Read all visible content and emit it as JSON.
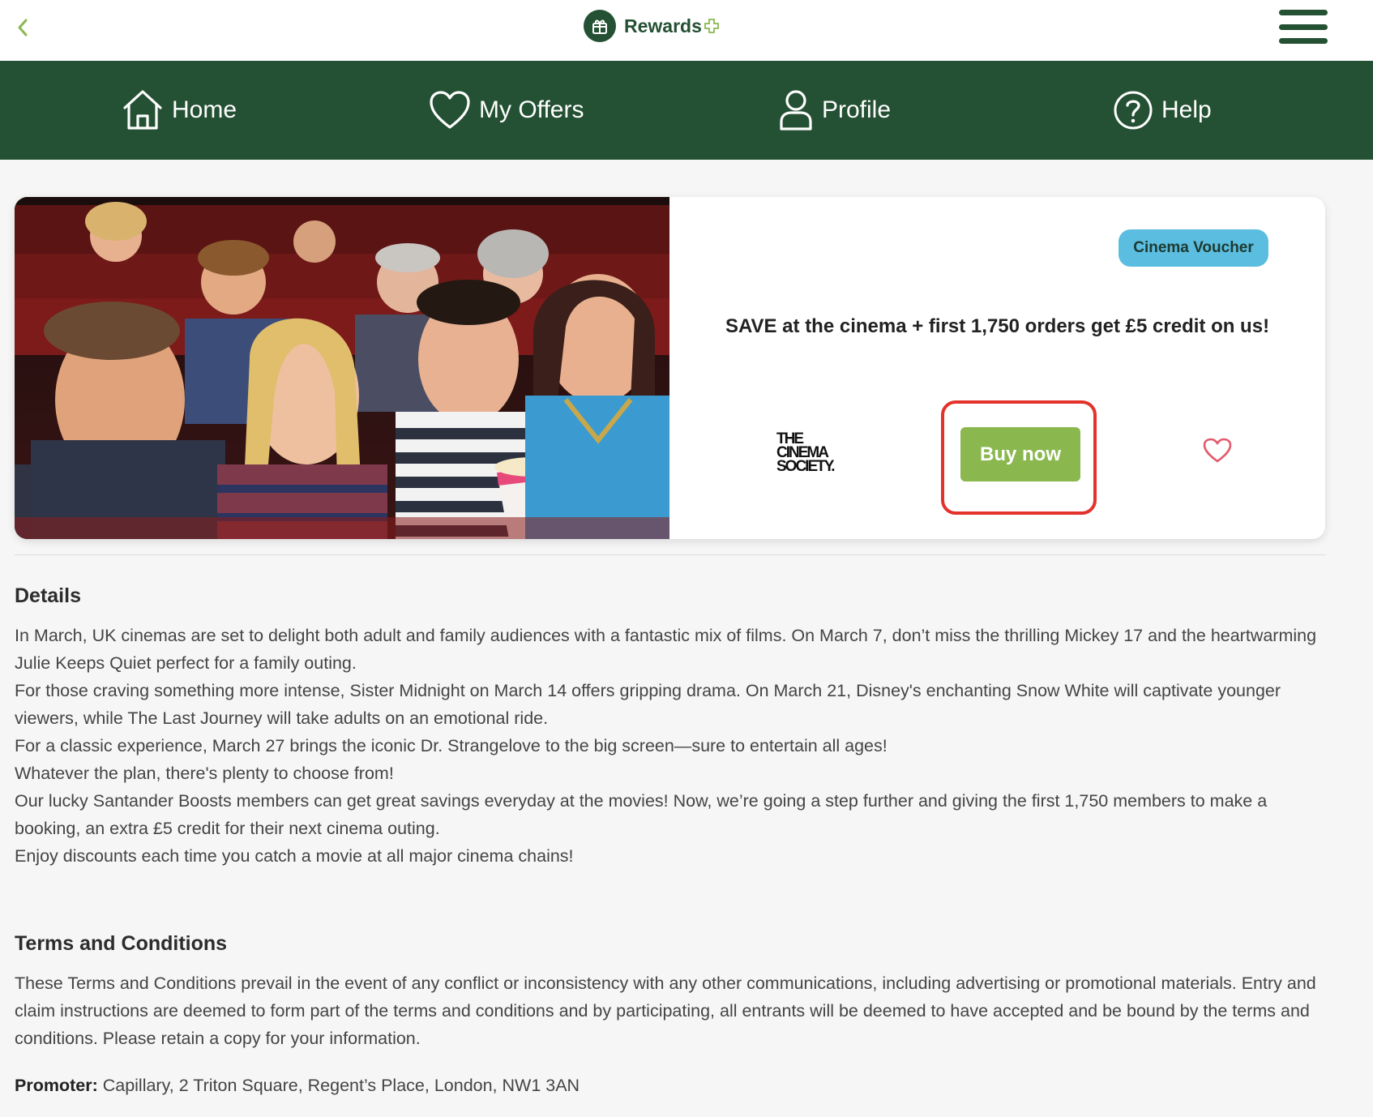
{
  "app": {
    "name": "Rewards",
    "brand_color": "#245033",
    "accent_color": "#8ab84f"
  },
  "topbar": {
    "back_icon": "chevron-left-icon",
    "brand_icon": "gift-icon",
    "menu_icon": "hamburger-menu-icon"
  },
  "nav": {
    "items": [
      {
        "label": "Home",
        "icon": "home-icon"
      },
      {
        "label": "My Offers",
        "icon": "heart-icon"
      },
      {
        "label": "Profile",
        "icon": "user-icon"
      },
      {
        "label": "Help",
        "icon": "help-circle-icon"
      }
    ]
  },
  "offer": {
    "badge": "Cinema Voucher",
    "badge_color": "#5bbde0",
    "title": "SAVE at the cinema + first 1,750 orders get £5 credit on us!",
    "partner_logo": [
      "THE",
      "CINEMA",
      "SOCIETY."
    ],
    "buy_label": "Buy now",
    "favorite_icon": "heart-outline-icon",
    "image": "cinema-audience-photo"
  },
  "details": {
    "heading": "Details",
    "paragraphs": [
      "In March, UK cinemas are set to delight both adult and family audiences with a fantastic mix of films. On March 7, don’t miss the thrilling Mickey 17 and the heartwarming Julie Keeps Quiet perfect for a family outing.",
      "For those craving something more intense, Sister Midnight on March 14 offers gripping drama. On March 21, Disney's enchanting Snow White will captivate younger viewers, while The Last Journey will take adults on an emotional ride.",
      "For a classic experience, March 27 brings the iconic Dr. Strangelove to the big screen—sure to entertain all ages!",
      "Whatever the plan, there's plenty to choose from!",
      "Our lucky Santander Boosts members can get great savings everyday at the movies! Now, we’re going a step further and giving the first 1,750 members to make a booking, an extra £5 credit for their next cinema outing.",
      "Enjoy discounts each time you catch a movie at all major cinema chains!"
    ]
  },
  "terms": {
    "heading": "Terms and Conditions",
    "paragraph": "These Terms and Conditions prevail in the event of any conflict or inconsistency with any other communications, including advertising or promotional materials. Entry and claim instructions are deemed to form part of the terms and conditions and by participating, all entrants will be deemed to have accepted and be bound by the terms and conditions. Please retain a copy for your information.",
    "promoter_label": "Promoter:",
    "promoter_value": " Capillary, 2 Triton Square, Regent’s Place, London, NW1 3AN"
  }
}
